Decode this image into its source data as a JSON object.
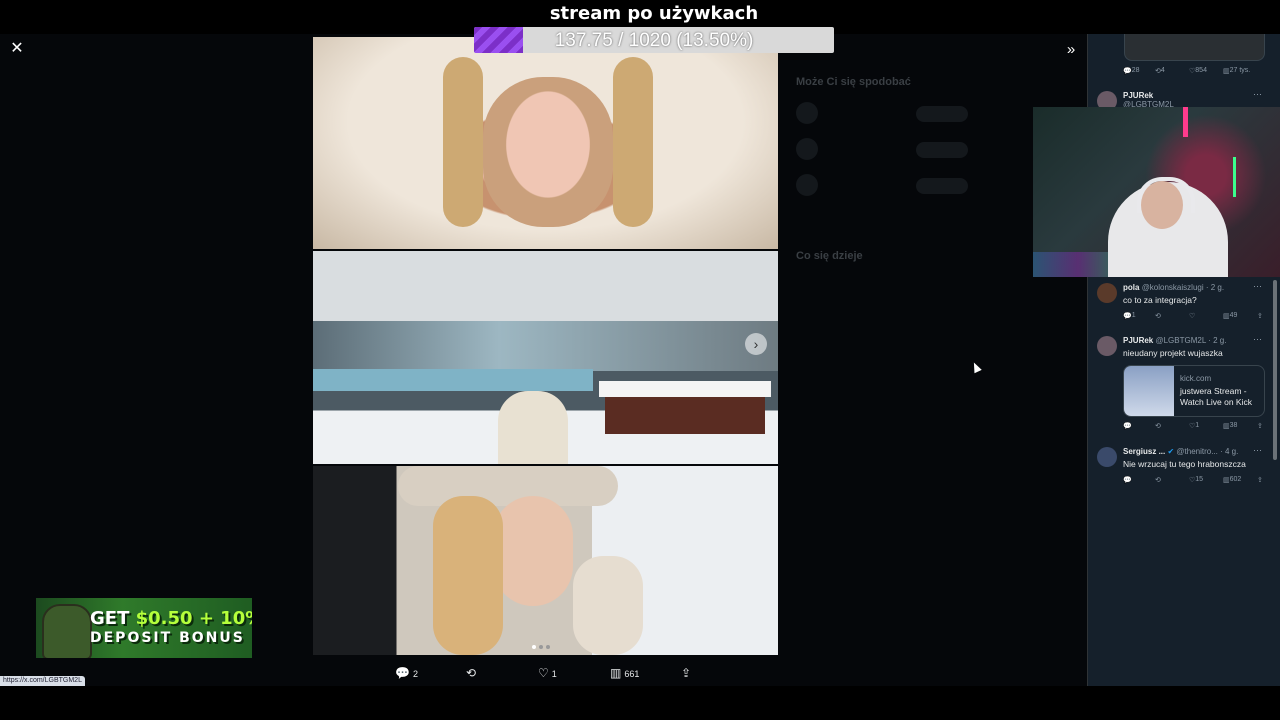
{
  "stream": {
    "title": "stream po używkach",
    "progress_text": "137.75 / 1020 (13.50%)",
    "progress_fraction": 0.135
  },
  "media_viewer": {
    "close_icon": "close-icon",
    "expand_icon": "double-chevron-right-icon",
    "next_icon": "chevron-right-icon",
    "carousel_dots": 3,
    "active_dot": 0,
    "actions": {
      "replies": "2",
      "reposts": "",
      "likes": "1",
      "views": "661"
    }
  },
  "background_ghost": {
    "who_to_follow": "Może Ci się spodobać",
    "trending": "Co się dzieje"
  },
  "status_url": "https://x.com/LGBTGM2L",
  "ad": {
    "line1_a": "GET ",
    "line1_b": "$0.50 + 10%",
    "line2": "DEPOSIT BONUS"
  },
  "feed": {
    "top_actions": {
      "replies": "28",
      "reposts": "4",
      "likes": "854",
      "views": "27 tys."
    },
    "tweets": [
      {
        "name": "PJURek",
        "handle": "@LGBTGM2L"
      },
      {
        "name": "pola",
        "handle": "@kolonskaiszlugi · 2 g.",
        "text": "co to za integracja?",
        "replies": "1",
        "reposts": "",
        "likes": "",
        "views": "49"
      },
      {
        "name": "PJURek",
        "handle": "@LGBTGM2L · 2 g.",
        "text": "nieudany projekt wujaszka",
        "replies": "",
        "reposts": "",
        "likes": "1",
        "views": "38",
        "card": {
          "domain": "kick.com",
          "title": "justwera Stream - Watch Live on Kick"
        }
      },
      {
        "name": "Sergiusz ...",
        "handle": "@thenitro... · 4 g.",
        "text": "Nie wrzucaj tu tego hrabonszcza",
        "replies": "",
        "reposts": "",
        "likes": "15",
        "views": "602"
      }
    ]
  }
}
